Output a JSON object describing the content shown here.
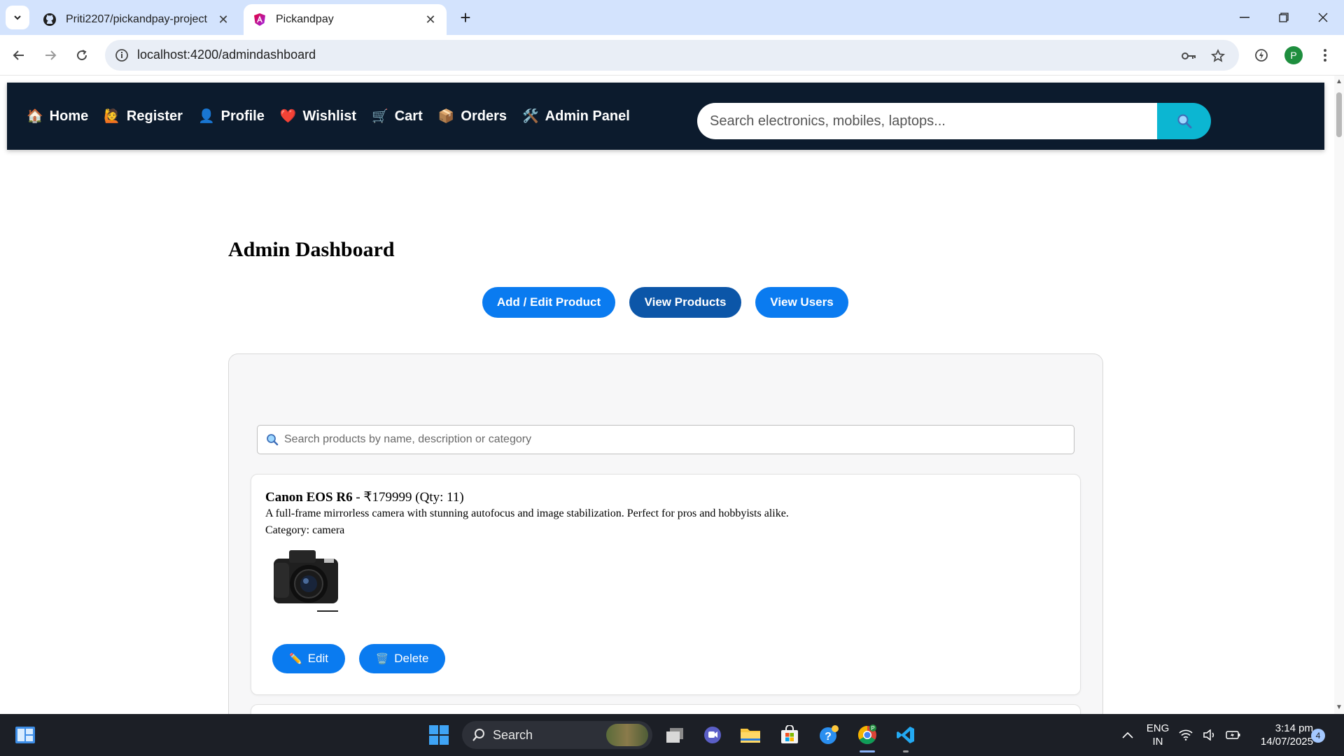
{
  "browser": {
    "tabs": [
      {
        "title": "Priti2207/pickandpay-project",
        "active": false,
        "icon": "github-icon"
      },
      {
        "title": "Pickandpay",
        "active": true,
        "icon": "angular-icon"
      }
    ],
    "new_tab_label": "+",
    "url": "localhost:4200/admindashboard",
    "profile_initial": "P"
  },
  "site": {
    "nav": [
      {
        "emoji": "🏠",
        "label": "Home"
      },
      {
        "emoji": "🙋",
        "label": "Register"
      },
      {
        "emoji": "👤",
        "label": "Profile"
      },
      {
        "emoji": "❤️",
        "label": "Wishlist"
      },
      {
        "emoji": "🛒",
        "label": "Cart"
      },
      {
        "emoji": "📦",
        "label": "Orders"
      },
      {
        "emoji": "🛠️",
        "label": "Admin Panel"
      }
    ],
    "search": {
      "placeholder": "Search electronics, mobiles, laptops...",
      "button_icon": "🔍"
    },
    "colors": {
      "nav_bg": "#0c1b2d",
      "search_btn": "#0cb6d2",
      "primary": "#0a7bf0",
      "primary_active": "#0c56a8"
    }
  },
  "dashboard": {
    "title": "Admin Dashboard",
    "buttons": [
      {
        "label": "Add / Edit Product",
        "active": false
      },
      {
        "label": "View Products",
        "active": true
      },
      {
        "label": "View Users",
        "active": false
      }
    ],
    "product_search": {
      "icon": "🔍",
      "placeholder": "Search products by name, description or category"
    },
    "products": [
      {
        "name": "Canon EOS R6",
        "price_text": " - ₹179999 (Qty: 11)",
        "description": "A full-frame mirrorless camera with stunning autofocus and image stabilization. Perfect for pros and hobbyists alike.",
        "category_text": "Category: camera",
        "edit_emoji": "✏️",
        "edit_label": "Edit",
        "delete_emoji": "🗑️",
        "delete_label": "Delete"
      }
    ]
  },
  "taskbar": {
    "search_label": "Search",
    "lang_line1": "ENG",
    "lang_line2": "IN",
    "time": "3:14 pm",
    "date": "14/07/2025",
    "notification_count": "4"
  }
}
